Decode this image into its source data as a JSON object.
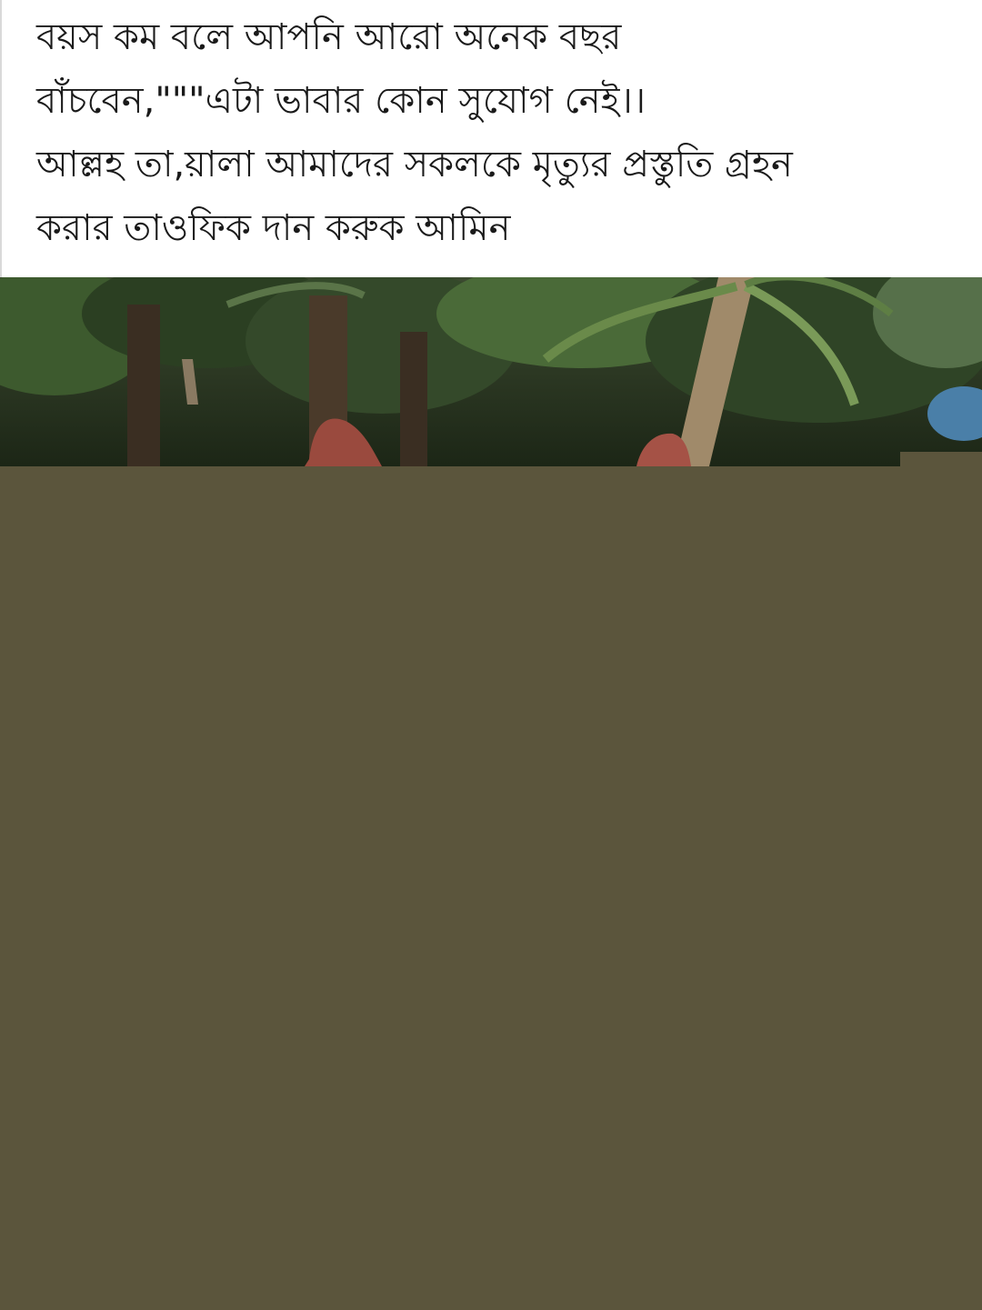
{
  "post": {
    "lines": [
      "বয়স কম বলে আপনি আরো অনেক বছর",
      "বাঁচবেন,\"\"\"এটা ভাবার কোন সুযোগ নেই।।",
      "আল্লহ তা,য়ালা আমাদের সকলকে মৃত্যুর প্রস্তুতি গ্রহন",
      "করার তাওফিক দান করুক আমিন"
    ]
  },
  "photo": {
    "loading_color": "#5b553c"
  }
}
